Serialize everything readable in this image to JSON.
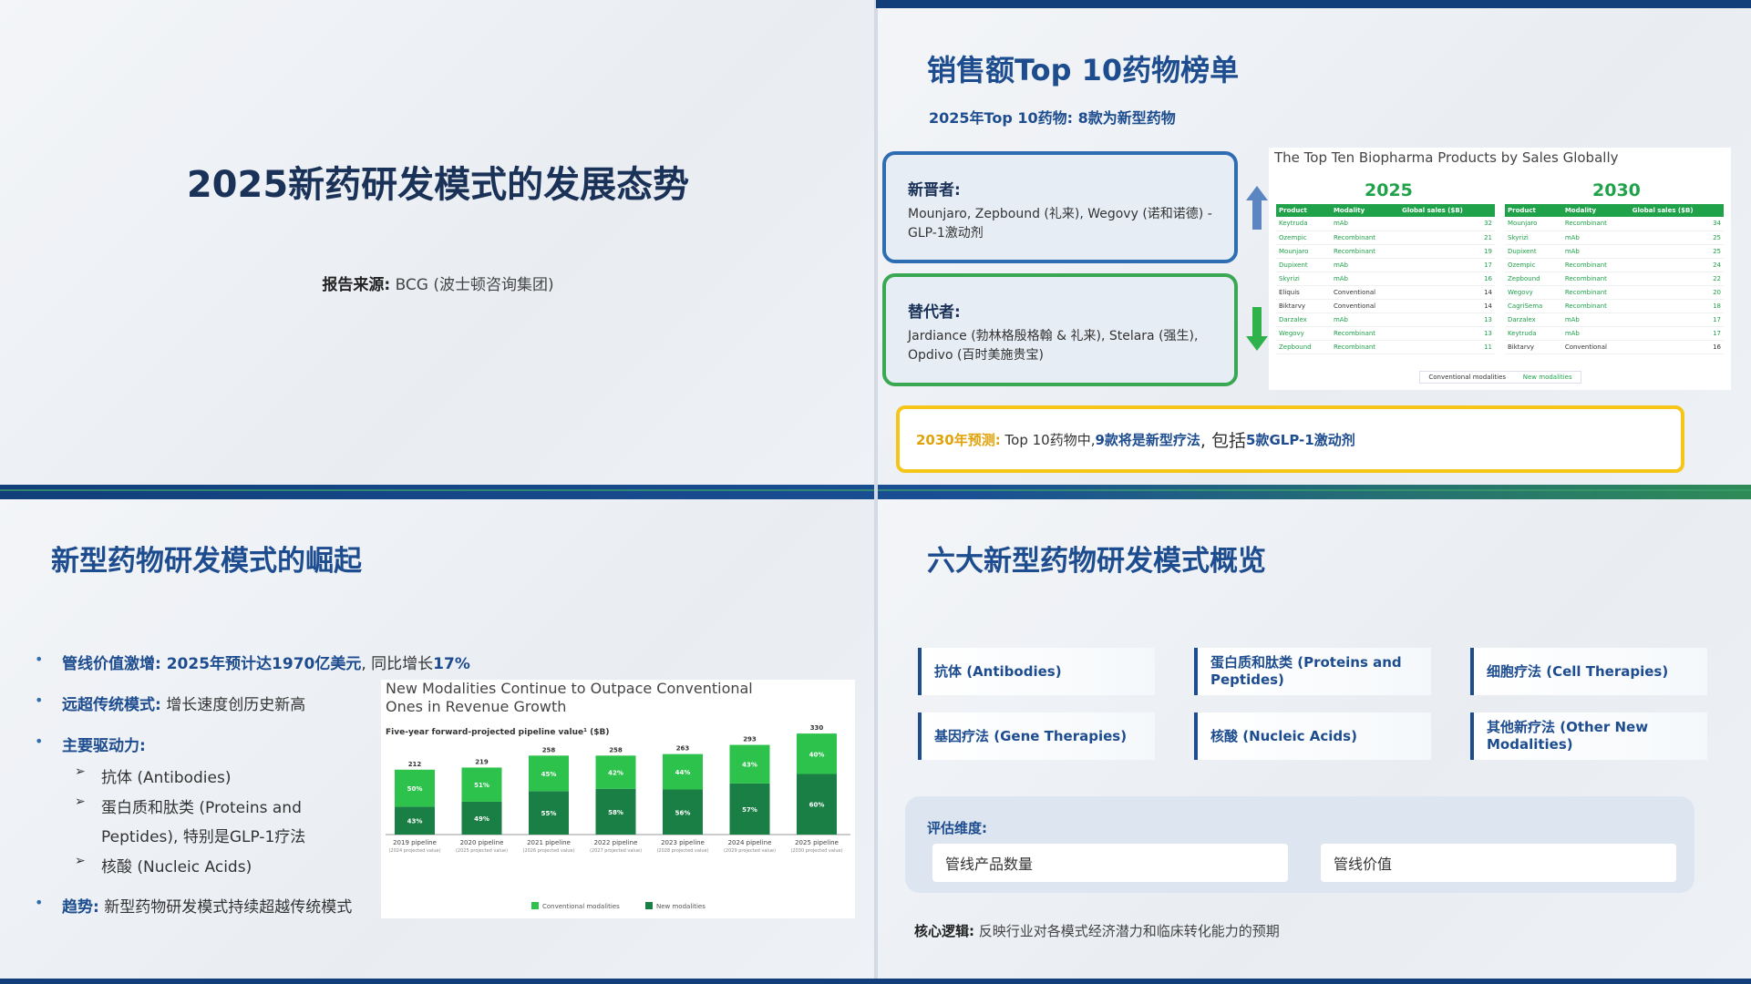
{
  "slide1": {
    "title": "2025新药研发模式的发展态势",
    "source_label": "报告来源:",
    "source_value": "BCG (波士顿咨询集团)"
  },
  "slide2": {
    "title": "销售额Top 10药物榜单",
    "subtitle": "2025年Top 10药物: 8款为新型药物",
    "newcomers": {
      "heading": "新晋者:",
      "text": "Mounjaro, Zepbound (礼来), Wegovy (诺和诺德) - GLP-1激动剂"
    },
    "replaced": {
      "heading": "替代者:",
      "text": "Jardiance (勃林格殷格翰 & 礼来), Stelara (强生), Opdivo (百时美施贵宝)"
    },
    "top_table": {
      "title": "The Top Ten Biopharma Products by Sales Globally",
      "headers": [
        "Product",
        "Modality",
        "Global sales ($B)"
      ],
      "legend": [
        "Conventional modalities",
        "New modalities"
      ],
      "y2025": {
        "label": "2025",
        "rows": [
          {
            "p": "Keytruda",
            "m": "mAb",
            "s": "32",
            "new": true
          },
          {
            "p": "Ozempic",
            "m": "Recombinant",
            "s": "21",
            "new": true
          },
          {
            "p": "Mounjaro",
            "m": "Recombinant",
            "s": "19",
            "new": true
          },
          {
            "p": "Dupixent",
            "m": "mAb",
            "s": "17",
            "new": true
          },
          {
            "p": "Skyrizi",
            "m": "mAb",
            "s": "16",
            "new": true
          },
          {
            "p": "Eliquis",
            "m": "Conventional",
            "s": "14",
            "new": false
          },
          {
            "p": "Biktarvy",
            "m": "Conventional",
            "s": "14",
            "new": false
          },
          {
            "p": "Darzalex",
            "m": "mAb",
            "s": "13",
            "new": true
          },
          {
            "p": "Wegovy",
            "m": "Recombinant",
            "s": "13",
            "new": true
          },
          {
            "p": "Zepbound",
            "m": "Recombinant",
            "s": "11",
            "new": true
          }
        ]
      },
      "y2030": {
        "label": "2030",
        "rows": [
          {
            "p": "Mounjaro",
            "m": "Recombinant",
            "s": "34",
            "new": true
          },
          {
            "p": "Skyrizi",
            "m": "mAb",
            "s": "25",
            "new": true
          },
          {
            "p": "Dupixent",
            "m": "mAb",
            "s": "25",
            "new": true
          },
          {
            "p": "Ozempic",
            "m": "Recombinant",
            "s": "24",
            "new": true
          },
          {
            "p": "Zepbound",
            "m": "Recombinant",
            "s": "22",
            "new": true
          },
          {
            "p": "Wegovy",
            "m": "Recombinant",
            "s": "20",
            "new": true
          },
          {
            "p": "CagriSema",
            "m": "Recombinant",
            "s": "18",
            "new": true
          },
          {
            "p": "Darzalex",
            "m": "mAb",
            "s": "17",
            "new": true
          },
          {
            "p": "Keytruda",
            "m": "mAb",
            "s": "17",
            "new": true
          },
          {
            "p": "Biktarvy",
            "m": "Conventional",
            "s": "16",
            "new": false
          }
        ]
      }
    },
    "prediction": {
      "label": "2030年预测:",
      "part1": "Top 10药物中,",
      "part2": "9款将是新型疗法",
      "part3": ", 包括",
      "part4": "5款GLP-1激动剂"
    },
    "colors": {
      "blue": "#2f6db3",
      "green": "#3aa852",
      "yellow": "#f5c518",
      "table_green": "#1fa24a"
    },
    "icons": [
      "arrow-up-icon",
      "arrow-down-icon"
    ]
  },
  "slide3": {
    "title": "新型药物研发模式的崛起",
    "bullets": [
      {
        "bold": "管线价值激增: 2025年预计达1970亿美元",
        "rest": ", 同比增长",
        "bold2": "17%"
      },
      {
        "bold": "远超传统模式:",
        "rest": " 增长速度创历史新高"
      },
      {
        "bold": "主要驱动力:",
        "rest": ""
      },
      {
        "bold": "趋势:",
        "rest": " 新型药物研发模式持续超越传统模式"
      }
    ],
    "sub_items": [
      "抗体 (Antibodies)",
      "蛋白质和肽类 (Proteins and",
      "Peptides), 特别是GLP-1疗法",
      "核酸 (Nucleic Acids)"
    ],
    "sub_marker": "➢"
  },
  "chart_data": {
    "type": "bar",
    "title": "New Modalities Continue to Outpace Conventional Ones in Revenue Growth",
    "subtitle": "Five-year forward-projected pipeline value¹ ($B)",
    "categories": [
      "2019 pipeline",
      "2020 pipeline",
      "2021 pipeline",
      "2022 pipeline",
      "2023 pipeline",
      "2024 pipeline",
      "2025 pipeline"
    ],
    "category_notes": [
      "(2024 projected value)",
      "(2025 projected value)",
      "(2026 projected value)",
      "(2027 projected value)",
      "(2028 projected value)",
      "(2029 projected value)",
      "(2030 projected value)"
    ],
    "totals": [
      212,
      219,
      258,
      258,
      263,
      293,
      330
    ],
    "series": [
      {
        "name": "New modalities",
        "values": [
          43,
          49,
          55,
          58,
          56,
          57,
          60
        ],
        "color": "#1a7f45"
      },
      {
        "name": "Conventional modalities",
        "values": [
          50,
          51,
          45,
          42,
          44,
          43,
          40
        ],
        "color": "#2cc24c"
      }
    ],
    "units": "percent of total"
  },
  "slide4": {
    "title": "六大新型药物研发模式概览",
    "modes": [
      "抗体 (Antibodies)",
      "蛋白质和肽类 (Proteins and Peptides)",
      "细胞疗法 (Cell Therapies)",
      "基因疗法 (Gene Therapies)",
      "核酸 (Nucleic Acids)",
      "其他新疗法 (Other New Modalities)"
    ],
    "eval_label": "评估维度:",
    "eval_items": [
      "管线产品数量",
      "管线价值"
    ],
    "core_label": "核心逻辑:",
    "core_text": "反映行业对各模式经济潜力和临床转化能力的预期"
  }
}
